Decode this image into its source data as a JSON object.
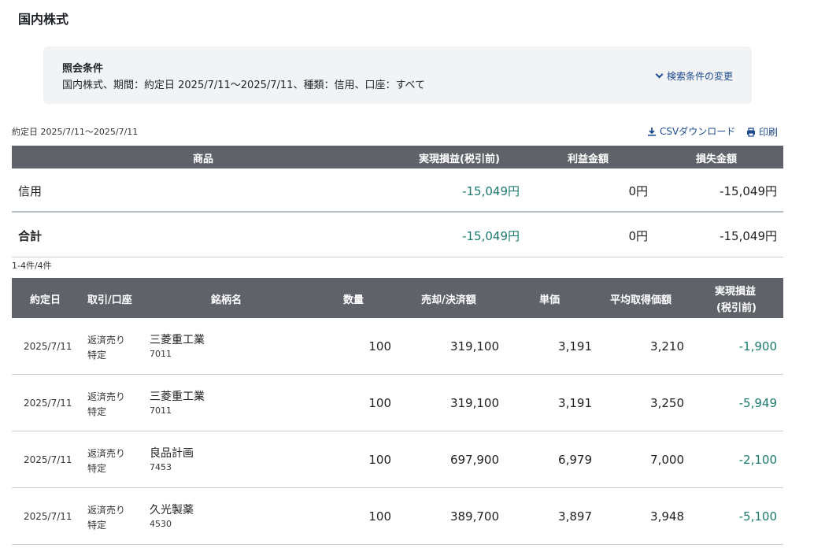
{
  "page": {
    "title": "国内株式"
  },
  "conditions": {
    "label": "照会条件",
    "value": "国内株式、期間：約定日 2025/7/11〜2025/7/11、種類：信用、口座：すべて",
    "change_link": "検索条件の変更"
  },
  "toolbar": {
    "range": "約定日 2025/7/11〜2025/7/11",
    "csv_label": "CSVダウンロード",
    "print_label": "印刷"
  },
  "summary": {
    "headers": {
      "product": "商品",
      "realized": "実現損益(税引前)",
      "profit": "利益金額",
      "loss": "損失金額"
    },
    "rows": [
      {
        "label": "信用",
        "realized": "-15,049円",
        "profit": "0円",
        "loss": "-15,049円"
      },
      {
        "label": "合計",
        "realized": "-15,049円",
        "profit": "0円",
        "loss": "-15,049円"
      }
    ]
  },
  "detail": {
    "count": "1-4件/4件",
    "headers": {
      "date": "約定日",
      "type": "取引/口座",
      "name": "銘柄名",
      "qty": "数量",
      "amount": "売却/決済額",
      "price": "単価",
      "avg": "平均取得価額",
      "pl_1": "実現損益",
      "pl_2": "(税引前)"
    },
    "rows": [
      {
        "date": "2025/7/11",
        "trade": "返済売り",
        "account": "特定",
        "name": "三菱重工業",
        "code": "7011",
        "qty": "100",
        "amount": "319,100",
        "price": "3,191",
        "avg": "3,210",
        "pl": "-1,900"
      },
      {
        "date": "2025/7/11",
        "trade": "返済売り",
        "account": "特定",
        "name": "三菱重工業",
        "code": "7011",
        "qty": "100",
        "amount": "319,100",
        "price": "3,191",
        "avg": "3,250",
        "pl": "-5,949"
      },
      {
        "date": "2025/7/11",
        "trade": "返済売り",
        "account": "特定",
        "name": "良品計画",
        "code": "7453",
        "qty": "100",
        "amount": "697,900",
        "price": "6,979",
        "avg": "7,000",
        "pl": "-2,100"
      },
      {
        "date": "2025/7/11",
        "trade": "返済売り",
        "account": "特定",
        "name": "久光製薬",
        "code": "4530",
        "qty": "100",
        "amount": "389,700",
        "price": "3,897",
        "avg": "3,948",
        "pl": "-5,100"
      }
    ]
  },
  "colors": {
    "header_bg": "#5f6369",
    "negative": "#1c7a6e",
    "link": "#1d4a8f",
    "panel_bg": "#f2f3f5"
  }
}
